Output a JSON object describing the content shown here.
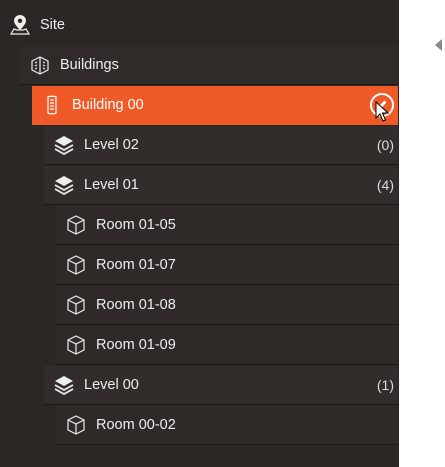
{
  "tree": {
    "site": {
      "label": "Site",
      "icon": "map-pin-icon"
    },
    "buildings": {
      "label": "Buildings",
      "icon": "buildings-icon"
    },
    "building00": {
      "label": "Building 00",
      "icon": "building-icon",
      "selected": true,
      "action_icon": "edit-pencil-icon"
    },
    "level02": {
      "label": "Level 02",
      "count": "(0)",
      "icon": "layers-icon"
    },
    "level01": {
      "label": "Level 01",
      "count": "(4)",
      "icon": "layers-icon"
    },
    "room0105": {
      "label": "Room 01-05",
      "icon": "cube-icon"
    },
    "room0107": {
      "label": "Room 01-07",
      "icon": "cube-icon"
    },
    "room0108": {
      "label": "Room 01-08",
      "icon": "cube-icon"
    },
    "room0109": {
      "label": "Room 01-09",
      "icon": "cube-icon"
    },
    "level00": {
      "label": "Level 00",
      "count": "(1)",
      "icon": "layers-icon"
    },
    "room0002": {
      "label": "Room 00-02",
      "icon": "cube-icon"
    }
  },
  "colors": {
    "panel_bg": "#2b2724",
    "selected_bg": "#f05a28",
    "text": "#eeeeee"
  }
}
